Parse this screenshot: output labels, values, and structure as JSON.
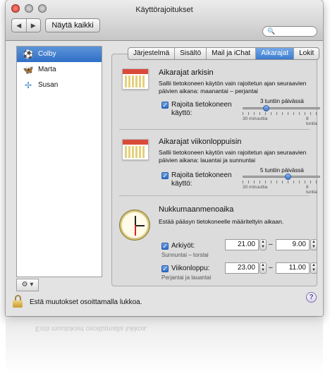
{
  "window": {
    "title": "Käyttörajoitukset",
    "back_glyph": "◀",
    "forward_glyph": "▶",
    "show_all_label": "Näytä kaikki",
    "search_glyph": "🔍"
  },
  "sidebar": {
    "users": [
      {
        "name": "Colby",
        "icon": "soccer-ball-icon",
        "glyph": "⚽",
        "selected": true
      },
      {
        "name": "Marta",
        "icon": "butterfly-icon",
        "glyph": "🦋",
        "selected": false
      },
      {
        "name": "Susan",
        "icon": "dragonfly-icon",
        "glyph": "✢",
        "selected": false
      }
    ],
    "gear_label": "⚙ ▾"
  },
  "tabs": [
    {
      "label": "Järjestelmä",
      "active": false
    },
    {
      "label": "Sisältö",
      "active": false
    },
    {
      "label": "Mail ja iChat",
      "active": false
    },
    {
      "label": "Aikarajat",
      "active": true
    },
    {
      "label": "Lokit",
      "active": false
    }
  ],
  "weekdays": {
    "title": "Aikarajat arkisin",
    "description": "Sallii tietokoneen käytön vain rajoitetun ajan seuraavien päivien aikana: maanantai – perjantai",
    "checkbox_label": "Rajoita tietokoneen käyttö:",
    "checked": true,
    "slider_value_label": "3 tuntiin päivässä",
    "slider_fraction": 0.3,
    "min_label": "30 minuuttia",
    "max_label": "8 tuntia"
  },
  "weekends": {
    "title": "Aikarajat viikonloppuisin",
    "description": "Sallii tietokoneen käytön vain rajoitetun ajan seuraavien päivien aikana: lauantai ja sunnuntai",
    "checkbox_label": "Rajoita tietokoneen käyttö:",
    "checked": true,
    "slider_value_label": "5 tuntiin päivässä",
    "slider_fraction": 0.58,
    "min_label": "30 minuuttia",
    "max_label": "8 tuntia"
  },
  "bedtime": {
    "title": "Nukkumaanmenoaika",
    "description": "Estää pääsyn tietokoneelle määriteltyin aikaan.",
    "school_nights": {
      "label": "Arkiyöt:",
      "sub": "Sunnuntai – torstai",
      "checked": true,
      "from": "21.00",
      "to": "9.00"
    },
    "weekend": {
      "label": "Viikonloppu:",
      "sub": "Perjantai ja lauantai",
      "checked": true,
      "from": "23.00",
      "to": "11.00"
    },
    "dash": "–"
  },
  "footer": {
    "lock_text": "Estä muutokset osoittamalla lukkoa.",
    "help_label": "?"
  },
  "colors": {
    "selection": "#3a78cf",
    "accent": "#2c6bc8"
  }
}
